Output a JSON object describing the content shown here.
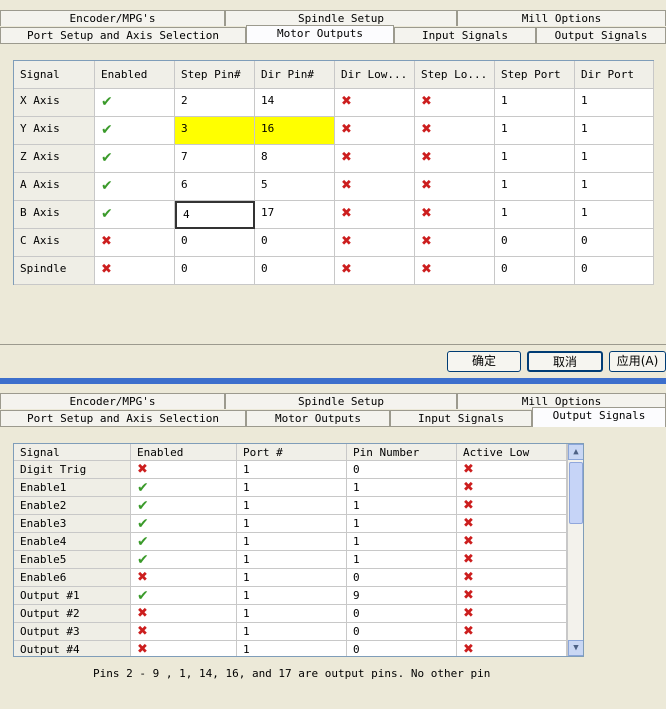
{
  "top": {
    "tabs_row1": [
      "Encoder/MPG's",
      "Spindle Setup",
      "Mill Options"
    ],
    "tabs_row2": [
      "Port Setup and Axis Selection",
      "Motor Outputs",
      "Input Signals",
      "Output Signals"
    ],
    "columns": [
      "Signal",
      "Enabled",
      "Step Pin#",
      "Dir Pin#",
      "Dir Low...",
      "Step Lo...",
      "Step Port",
      "Dir Port"
    ],
    "rows": [
      {
        "signal": "X Axis",
        "enabled": true,
        "step_pin": "2",
        "dir_pin": "14",
        "step_port": "1",
        "dir_port": "1"
      },
      {
        "signal": "Y Axis",
        "enabled": true,
        "step_pin": "3",
        "dir_pin": "16",
        "step_port": "1",
        "dir_port": "1"
      },
      {
        "signal": "Z Axis",
        "enabled": true,
        "step_pin": "7",
        "dir_pin": "8",
        "step_port": "1",
        "dir_port": "1"
      },
      {
        "signal": "A Axis",
        "enabled": true,
        "step_pin": "6",
        "dir_pin": "5",
        "step_port": "1",
        "dir_port": "1"
      },
      {
        "signal": "B Axis",
        "enabled": true,
        "step_pin": "4",
        "dir_pin": "17",
        "step_port": "1",
        "dir_port": "1"
      },
      {
        "signal": "C Axis",
        "enabled": false,
        "step_pin": "0",
        "dir_pin": "0",
        "step_port": "0",
        "dir_port": "0"
      },
      {
        "signal": "Spindle",
        "enabled": false,
        "step_pin": "0",
        "dir_pin": "0",
        "step_port": "0",
        "dir_port": "0"
      }
    ],
    "buttons": {
      "ok": "确定",
      "cancel": "取消",
      "apply": "应用(A)"
    }
  },
  "bottom": {
    "tabs_row1": [
      "Encoder/MPG's",
      "Spindle Setup",
      "Mill Options"
    ],
    "tabs_row2": [
      "Port Setup and Axis Selection",
      "Motor Outputs",
      "Input Signals",
      "Output Signals"
    ],
    "columns": [
      "Signal",
      "Enabled",
      "Port #",
      "Pin Number",
      "Active Low"
    ],
    "rows": [
      {
        "signal": "Digit  Trig",
        "enabled": false,
        "port": "1",
        "pin": "0"
      },
      {
        "signal": "Enable1",
        "enabled": true,
        "port": "1",
        "pin": "1"
      },
      {
        "signal": "Enable2",
        "enabled": true,
        "port": "1",
        "pin": "1"
      },
      {
        "signal": "Enable3",
        "enabled": true,
        "port": "1",
        "pin": "1"
      },
      {
        "signal": "Enable4",
        "enabled": true,
        "port": "1",
        "pin": "1"
      },
      {
        "signal": "Enable5",
        "enabled": true,
        "port": "1",
        "pin": "1"
      },
      {
        "signal": "Enable6",
        "enabled": false,
        "port": "1",
        "pin": "0"
      },
      {
        "signal": "Output #1",
        "enabled": true,
        "port": "1",
        "pin": "9"
      },
      {
        "signal": "Output #2",
        "enabled": false,
        "port": "1",
        "pin": "0"
      },
      {
        "signal": "Output #3",
        "enabled": false,
        "port": "1",
        "pin": "0"
      },
      {
        "signal": "Output #4",
        "enabled": false,
        "port": "1",
        "pin": "0"
      }
    ],
    "note": "Pins 2 - 9 , 1, 14, 16, and 17 are output pins. No  other pin"
  },
  "icons": {
    "enabled": "check-icon",
    "disabled": "x-icon"
  },
  "colors": {
    "highlight": "#ffff00",
    "check": "#3a9a2a",
    "cross": "#cc1e1e",
    "separator": "#3d6fcc"
  }
}
